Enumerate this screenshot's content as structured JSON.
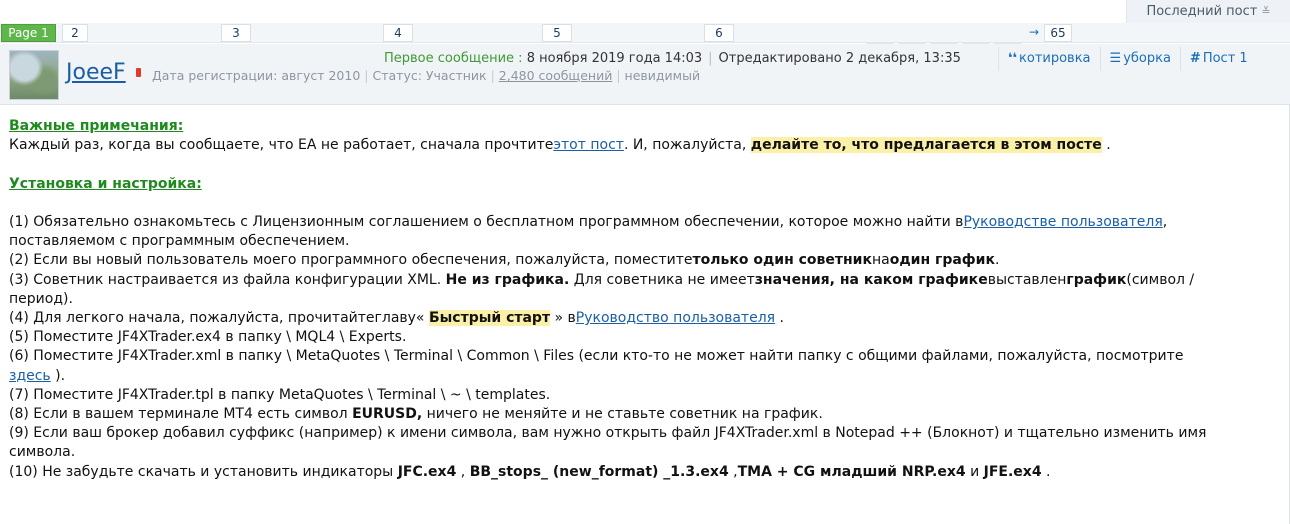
{
  "topbar": {
    "last_post": "Последний пост",
    "last_post_icon": "sort-down-icon"
  },
  "pager": {
    "current": "Page 1",
    "pages": [
      "2",
      "3",
      "4",
      "5",
      "6"
    ],
    "next_arrow": "→",
    "last": "65"
  },
  "post": {
    "username": "JoeeF",
    "reg_label": "Дата регистрации: август 2010",
    "status": "Статус: Участник",
    "messages": "2,480 сообщений",
    "invisible": "невидимый",
    "first_msg_label": "Первое сообщение :",
    "first_msg_date": "8 ноября 2019 года 14:03",
    "edited": "Отредактировано 2 декабря, 13:35",
    "actions": {
      "quote": "котировка",
      "cleanup": "уборка",
      "post_no": "Пост 1"
    }
  },
  "body": {
    "h1": "Важные примечания:",
    "p1_a": "Каждый раз, когда вы сообщаете, что EA не работает, сначала прочтите",
    "p1_link": "этот пост",
    "p1_b": ". И, пожалуйста,",
    "p1_hl": "делайте то, что предлагается в этом посте",
    "p1_c": ".",
    "h2": "Установка и настройка:",
    "l1_a": "(1) Обязательно ознакомьтесь с Лицензионным соглашением о бесплатном программном обеспечении, которое можно найти в",
    "l1_link": "Руководстве пользователя",
    "l1_b": ",",
    "l1_c": "поставляемом с программным обеспечением.",
    "l2_a": "(2) Если вы новый пользователь моего программного обеспечения, пожалуйста, поместите",
    "l2_b1": "только один советник",
    "l2_b": "на",
    "l2_b2": "один график",
    "l2_c": ".",
    "l3_a": "(3) Советник настраивается из файла конфигурации XML.",
    "l3_b1": "Не из графика.",
    "l3_b": "Для советника не имеет",
    "l3_b2": "значения, на каком графике",
    "l3_c": "выставлен",
    "l3_b3": "график",
    "l3_d": "(символ /",
    "l3_e": "период).",
    "l4_a": "(4) Для легкого начала, пожалуйста, прочитайте",
    "l4_b": "главу«",
    "l4_hl": "Быстрый старт",
    "l4_c": "» в",
    "l4_link": "Руководство пользователя",
    "l4_d": ".",
    "l5": "(5) Поместите JF4XTrader.ex4 в папку \\ MQL4 \\ Experts.",
    "l6_a": "(6) Поместите JF4XTrader.xml в папку \\ MetaQuotes \\ Terminal \\ Common \\ Files (если кто-то не может найти папку с общими файлами, пожалуйста, посмотрите",
    "l6_link": "здесь",
    "l6_b": ").",
    "l7": "(7) Поместите JF4XTrader.tpl в папку MetaQuotes \\ Terminal \\ ~ \\ templates.",
    "l8_a": "(8) Если в вашем терминале МТ4 есть символ",
    "l8_b": "EURUSD,",
    "l8_c": "ничего не меняйте и не ставьте советник на график.",
    "l9_a": "(9) Если ваш брокер добавил суффикс (например) к имени символа, вам нужно открыть файл JF4XTrader.xml в Notepad ++ (Блокнот) и тщательно изменить имя",
    "l9_b": "символа.",
    "l10_a": "(10) Не забудьте скачать и установить индикаторы",
    "l10_b1": "JFC.ex4",
    "l10_s1": ",",
    "l10_b2": "BB_stops_ (new_format) _1.3.ex4",
    "l10_s2": ",",
    "l10_b3": "TMA + CG младший NRP.ex4",
    "l10_s3": "и",
    "l10_b4": "JFE.ex4",
    "l10_s4": "."
  }
}
